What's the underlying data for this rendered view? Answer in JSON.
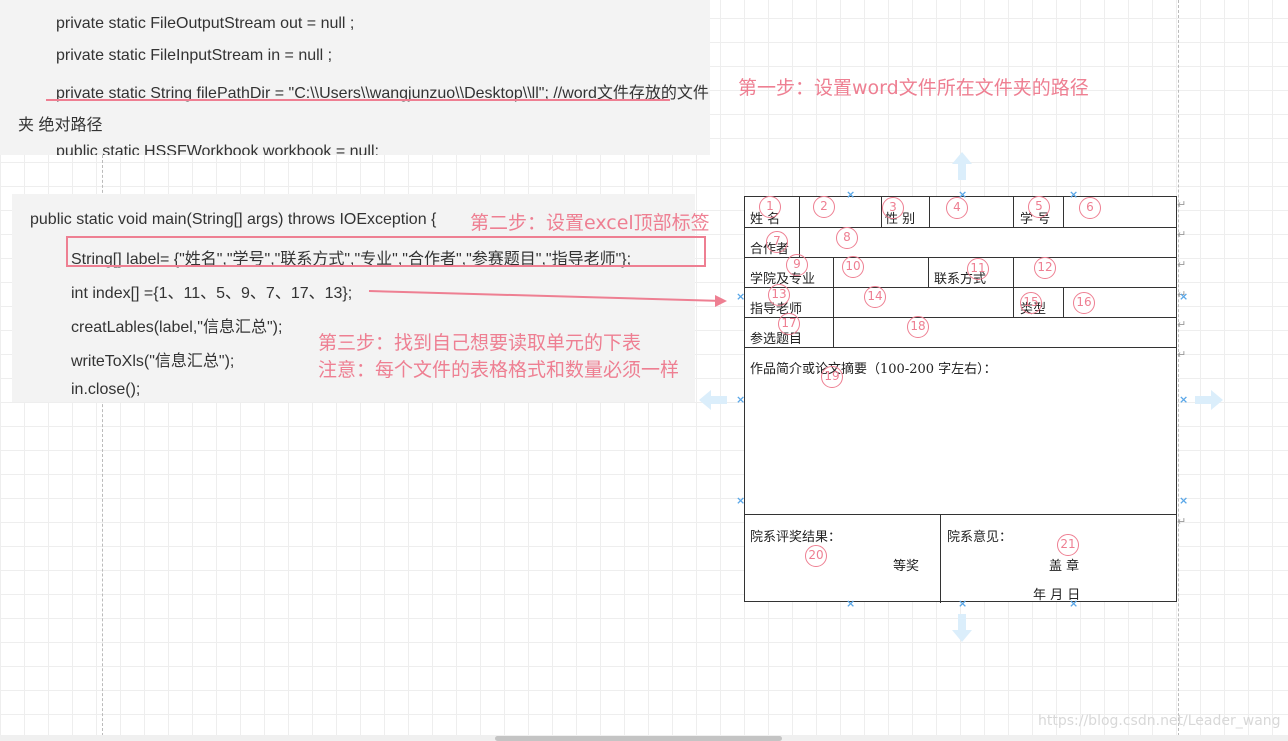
{
  "code_top": {
    "lines": [
      "private static FileOutputStream out = null ;",
      "private static FileInputStream in = null ;",
      "private static String filePathDir = \"C:\\\\Users\\\\wangjunzuo\\\\Desktop\\\\ll\";  //word文件存放的文件",
      "夹 绝对路径",
      "public static HSSFWorkbook workbook = null;"
    ]
  },
  "code_main": {
    "lines": [
      "public static void main(String[] args) throws IOException {",
      "String[] label= {\"姓名\",\"学号\",\"联系方式\",\"专业\",\"合作者\",\"参赛题目\",\"指导老师\"};",
      "int index[] ={1、11、5、9、7、17、13};",
      "creatLables(label,\"信息汇总\");",
      "writeToXls(\"信息汇总\");",
      "in.close();"
    ]
  },
  "annotations": {
    "step1": "第一步：设置word文件所在文件夹的路径",
    "step2": "第二步：设置excel顶部标签",
    "step3_line1": "第三步：找到自己想要读取单元的下表",
    "step3_line2": "注意：每个文件的表格格式和数量必须一样"
  },
  "form": {
    "name": "姓  名",
    "gender": "性  别",
    "student_id": "学  号",
    "collaborator": "合作者",
    "college_major": "学院及专业",
    "contact": "联系方式",
    "advisor": "指导老师",
    "type": "类型",
    "topic": "参选题目",
    "abstract": "作品简介或论文摘要（100-200 字左右）：",
    "award_result": "院系评奖结果：",
    "award_level": "等奖",
    "dept_opinion": "院系意见：",
    "seal": "盖  章",
    "date": "年    月    日"
  },
  "markers": [
    "1",
    "2",
    "3",
    "4",
    "5",
    "6",
    "7",
    "8",
    "9",
    "10",
    "11",
    "12",
    "13",
    "14",
    "15",
    "16",
    "17",
    "18",
    "19",
    "20",
    "21"
  ],
  "watermark": "https://blog.csdn.net/Leader_wang",
  "colors": {
    "annotation": "#ee7f92",
    "handle": "#5aa7e8"
  }
}
